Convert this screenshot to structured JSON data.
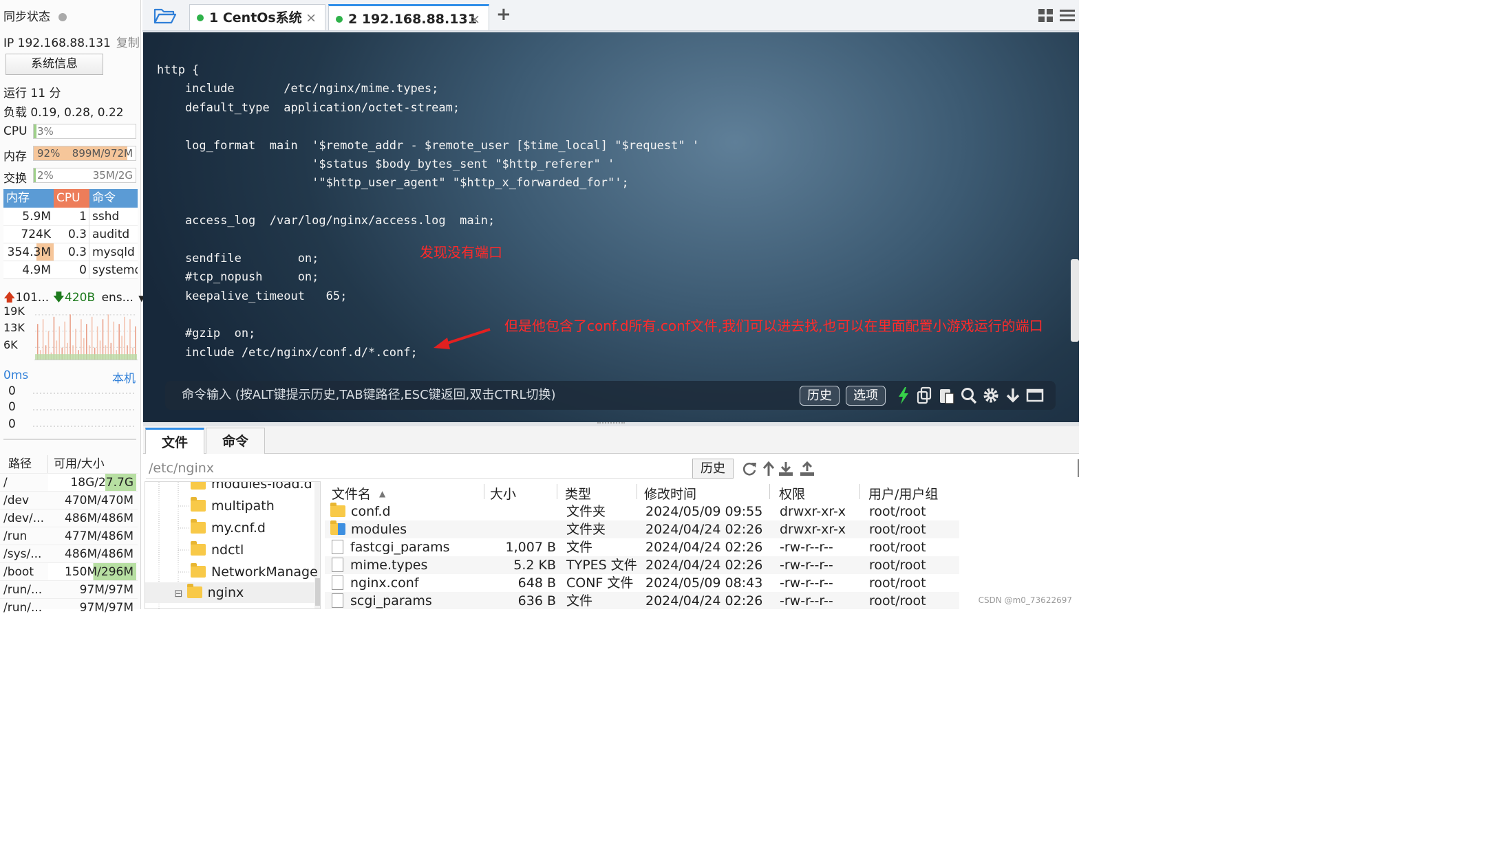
{
  "sidebar": {
    "sync_status_label": "同步状态",
    "ip_label": "IP 192.168.88.131",
    "copy_label": "复制",
    "sysinfo_button": "系统信息",
    "uptime": "运行 11 分",
    "load": "负载 0.19, 0.28, 0.22",
    "cpu": {
      "label": "CPU",
      "value": "3%",
      "fraction": 0.03
    },
    "memory": {
      "label": "内存",
      "value": "92%",
      "detail": "899M/972M",
      "fraction": 0.92
    },
    "swap": {
      "label": "交换",
      "value": "2%",
      "detail": "35M/2G",
      "fraction": 0.02
    },
    "process_headers": [
      "内存",
      "CPU",
      "命令"
    ],
    "processes": [
      {
        "mem": "5.9M",
        "cpu": "1",
        "cmd": "sshd"
      },
      {
        "mem": "724K",
        "cpu": "0.3",
        "cmd": "auditd"
      },
      {
        "mem": "354.3M",
        "cpu": "0.3",
        "cmd": "mysqld"
      },
      {
        "mem": "4.9M",
        "cpu": "0",
        "cmd": "systemd"
      }
    ],
    "network": {
      "up": "101...",
      "down": "420B",
      "iface": "ens...",
      "ticks": [
        "19K",
        "13K",
        "6K"
      ]
    },
    "ping": {
      "latency": "0ms",
      "target": "本机",
      "values": [
        "0",
        "0",
        "0"
      ]
    },
    "disk_headers": [
      "路径",
      "可用/大小"
    ],
    "disks": [
      {
        "path": "/",
        "size": "18G/27.7G",
        "used_fraction": 0.35
      },
      {
        "path": "/dev",
        "size": "470M/470M",
        "used_fraction": 0
      },
      {
        "path": "/dev/...",
        "size": "486M/486M",
        "used_fraction": 0
      },
      {
        "path": "/run",
        "size": "477M/486M",
        "used_fraction": 0.02
      },
      {
        "path": "/sys/...",
        "size": "486M/486M",
        "used_fraction": 0
      },
      {
        "path": "/boot",
        "size": "150M/296M",
        "used_fraction": 0.49
      },
      {
        "path": "/run/...",
        "size": "97M/97M",
        "used_fraction": 0
      },
      {
        "path": "/run/...",
        "size": "97M/97M",
        "used_fraction": 0
      }
    ]
  },
  "tabs": [
    {
      "label": "1 CentOs系统",
      "close": "×"
    },
    {
      "label": "2 192.168.88.131",
      "close": "×"
    }
  ],
  "add_tab": "+",
  "terminal": {
    "lines": [
      "http {",
      "    include       /etc/nginx/mime.types;",
      "    default_type  application/octet-stream;",
      "",
      "    log_format  main  '$remote_addr - $remote_user [$time_local] \"$request\" '",
      "                      '$status $body_bytes_sent \"$http_referer\" '",
      "                      '\"$http_user_agent\" \"$http_x_forwarded_for\"';",
      "",
      "    access_log  /var/log/nginx/access.log  main;",
      "",
      "    sendfile        on;",
      "    #tcp_nopush     on;",
      "    keepalive_timeout   65;",
      "",
      "    #gzip  on;",
      "    include /etc/nginx/conf.d/*.conf;"
    ],
    "annotation_1": "发现没有端口",
    "annotation_2": "但是他包含了conf.d所有.conf文件,我们可以进去找,也可以在里面配置小游戏运行的端口",
    "annotation_color": "#ff2a2a",
    "command_placeholder": "命令输入 (按ALT键提示历史,TAB键路径,ESC键返回,双击CTRL切换)",
    "history_button": "历史",
    "options_button": "选项"
  },
  "bottom_tabs": [
    "文件",
    "命令"
  ],
  "file_browser": {
    "path": "/etc/nginx",
    "history_button": "历史",
    "tree": [
      {
        "name": "modules-load.d"
      },
      {
        "name": "multipath"
      },
      {
        "name": "my.cnf.d"
      },
      {
        "name": "ndctl"
      },
      {
        "name": "NetworkManage"
      },
      {
        "name": "nginx",
        "expander": "⊟"
      }
    ],
    "columns": [
      "文件名",
      "大小",
      "类型",
      "修改时间",
      "权限",
      "用户/用户组"
    ],
    "sort_indicator": "▲",
    "files": [
      {
        "name": "conf.d",
        "size": "",
        "type": "文件夹",
        "modified": "2024/05/09 09:55",
        "perm": "drwxr-xr-x",
        "owner": "root/root",
        "icon": "folder"
      },
      {
        "name": "modules",
        "size": "",
        "type": "文件夹",
        "modified": "2024/04/24 02:26",
        "perm": "drwxr-xr-x",
        "owner": "root/root",
        "icon": "folder-link"
      },
      {
        "name": "fastcgi_params",
        "size": "1,007 B",
        "type": "文件",
        "modified": "2024/04/24 02:26",
        "perm": "-rw-r--r--",
        "owner": "root/root",
        "icon": "file"
      },
      {
        "name": "mime.types",
        "size": "5.2 KB",
        "type": "TYPES 文件",
        "modified": "2024/04/24 02:26",
        "perm": "-rw-r--r--",
        "owner": "root/root",
        "icon": "file"
      },
      {
        "name": "nginx.conf",
        "size": "648 B",
        "type": "CONF 文件",
        "modified": "2024/05/09 08:43",
        "perm": "-rw-r--r--",
        "owner": "root/root",
        "icon": "file"
      },
      {
        "name": "scgi_params",
        "size": "636 B",
        "type": "文件",
        "modified": "2024/04/24 02:26",
        "perm": "-rw-r--r--",
        "owner": "root/root",
        "icon": "file"
      }
    ]
  },
  "watermark": "CSDN @m0_73622697",
  "colors": {
    "accent": "#2f8ee8",
    "process_header": "#5b9bd5",
    "cpu_header": "#ed7d5a",
    "mem_fill": "#f6c69a",
    "green": "#2fb24a"
  }
}
